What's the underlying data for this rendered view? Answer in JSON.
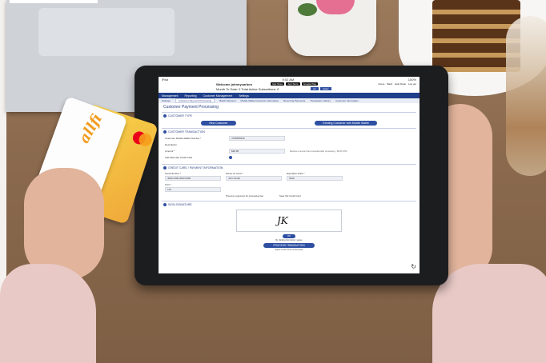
{
  "scene": {
    "objects": [
      "laptop",
      "potted-flower",
      "chocolate-cake",
      "latte-glass",
      "credit-cards",
      "tablet"
    ]
  },
  "cards": {
    "brand_logo": "allfi"
  },
  "tablet": {
    "status_left": "iPad",
    "status_time": "9:02 AM",
    "status_right": "100%",
    "welcome_line": "Welcome johnnycarbon",
    "month_line": "Month To Date: 0     Total Active Subscribers: 0",
    "store_buttons": [
      "App Store",
      "App Store",
      "Google Play"
    ],
    "top_links": [
      "Home",
      "Back",
      "Help Desk",
      "Log out"
    ],
    "go_buttons": [
      "Go",
      "Apply"
    ],
    "nav": [
      "Management",
      "Reporting",
      "Customer Management",
      "Settings"
    ],
    "subtabs": [
      "Settings",
      "Customer Payment Processing",
      "Batch Payment",
      "Mobile Wallet Customer Information",
      "Recurring Payments",
      "Transaction History",
      "Customer Information"
    ],
    "page_title": "Customer Payment Processing",
    "customer_type_heading": "CUSTOMER TYPE",
    "new_customer_btn": "New Customer",
    "existing_customer_btn": "Existing Customer with Mobile Wallet",
    "customer_txn_heading": "CUSTOMER TRANSACTION",
    "fields": [
      {
        "label": "Customer Mobile Wallet Number *",
        "value": "7045558346",
        "hint": ""
      },
      {
        "label": "Description",
        "value": "",
        "hint": ""
      },
      {
        "label": "Amount *",
        "value": "$48.95",
        "hint": "Maximum amount has exceeded after processing - $0.00 (0%)"
      },
      {
        "label": "Add Alternate Credit Card",
        "value": "",
        "hint": ""
      }
    ],
    "card_info_heading": "CREDIT CARD / PAYMENT INFORMATION",
    "card_cols": [
      {
        "label": "Card Number *",
        "value": "4000 2300 0000 0000"
      },
      {
        "label": "Name on Card *",
        "value": "John Smith"
      },
      {
        "label": "Expiration Date *",
        "value": "0429"
      }
    ],
    "cvv_label": "CVV *",
    "cvv_value": "123",
    "check1": "Process a payment for processing fee",
    "check2": "Save this Credit Card",
    "signature_heading": "SIGN SIGNATURE",
    "signature_text": "JK",
    "ok_label": "OK",
    "agree_text": "By clicking the button I agree",
    "process_btn": "PROCESS TRANSACTION",
    "footer_text": "Agree to the Terms & Services"
  }
}
